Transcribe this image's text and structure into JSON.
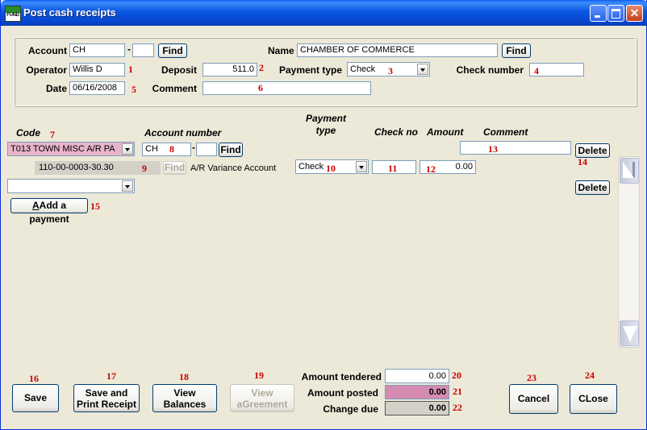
{
  "window": {
    "title": "Post cash receipts",
    "app_icon_text": "FUND"
  },
  "header": {
    "account_label": "Account",
    "account_value": "CH",
    "account_dash": "-",
    "account_sub_value": "",
    "find_label": "Find",
    "name_label": "Name",
    "name_value": "CHAMBER OF COMMERCE",
    "operator_label": "Operator",
    "operator_value": "Willis D",
    "deposit_label": "Deposit",
    "deposit_value": "511.0",
    "payment_type_label": "Payment type",
    "payment_type_value": "Check",
    "check_number_label": "Check number",
    "check_number_value": "",
    "date_label": "Date",
    "date_value": "06/16/2008",
    "comment_label": "Comment",
    "comment_value": ""
  },
  "columns": {
    "code": "Code",
    "account_number": "Account number",
    "payment_type": "Payment type",
    "check_no": "Check no",
    "amount": "Amount",
    "comment": "Comment"
  },
  "row1": {
    "code_value": "T013    TOWN MISC A/R PA",
    "account_value": "CH",
    "account_dash": "-",
    "account_sub_value": "",
    "find_label": "Find",
    "comment_value": "",
    "delete_label": "Delete"
  },
  "row2": {
    "gl_account": "110-00-0003-30.30",
    "find_label": "Find",
    "variance_label": "A/R Variance Account",
    "payment_type_value": "Check",
    "check_no_value": "",
    "amount_value": "0.00"
  },
  "row3": {
    "code_value": "",
    "delete_label": "Delete"
  },
  "add_payment_label": "Add a payment",
  "add_payment_hotkey": "A",
  "buttons": {
    "save": "Save",
    "save_print_line1": "Save and",
    "save_print_line2": "Print Receipt",
    "view_balances_line1": "View",
    "view_balances_line2": "Balances",
    "view_agreement_line1": "View",
    "view_agreement_line2": "aGreement",
    "cancel": "Cancel",
    "close": "CLose"
  },
  "totals": {
    "amount_tendered_label": "Amount tendered",
    "amount_tendered_value": "0.00",
    "amount_posted_label": "Amount posted",
    "amount_posted_value": "0.00",
    "change_due_label": "Change due",
    "change_due_value": "0.00"
  },
  "callouts": [
    "1",
    "2",
    "3",
    "4",
    "5",
    "6",
    "7",
    "8",
    "9",
    "10",
    "11",
    "12",
    "13",
    "14",
    "15",
    "16",
    "17",
    "18",
    "19",
    "20",
    "21",
    "22",
    "23",
    "24"
  ],
  "colors": {
    "titlebar": "#0a56e0",
    "window_bg": "#ece9d8",
    "pink_field": "#d68bb2",
    "callout": "#cc0000"
  }
}
